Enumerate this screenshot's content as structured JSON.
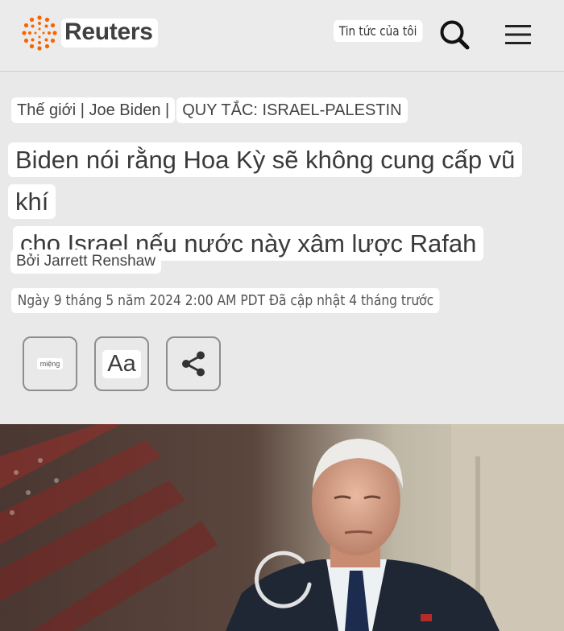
{
  "header": {
    "brand": "Reuters",
    "my_news_label": "Tin tức của tôi",
    "search_icon": "search-icon",
    "menu_icon": "hamburger-menu-icon",
    "brand_color": "#fa6400"
  },
  "article": {
    "kicker": {
      "section": "Thế giới",
      "topic": "Joe Biden",
      "rules": "QUY TẮC: ISRAEL-PALESTIN",
      "separator": "|"
    },
    "headline_line1": "Biden nói rằng Hoa Kỳ sẽ không cung cấp vũ khí",
    "headline_line2": "cho Israel nếu nước này xâm lược Rafah",
    "byline": "Bởi Jarrett Renshaw",
    "dateline": "Ngày 9 tháng 5 năm 2024 2:00 AM PDT Đã cập nhật 4 tháng trước"
  },
  "tools": {
    "listen_label": "miệng",
    "text_size_label": "Aa",
    "share_icon": "share-icon"
  },
  "hero": {
    "loading_icon": "loading-spinner-icon"
  }
}
